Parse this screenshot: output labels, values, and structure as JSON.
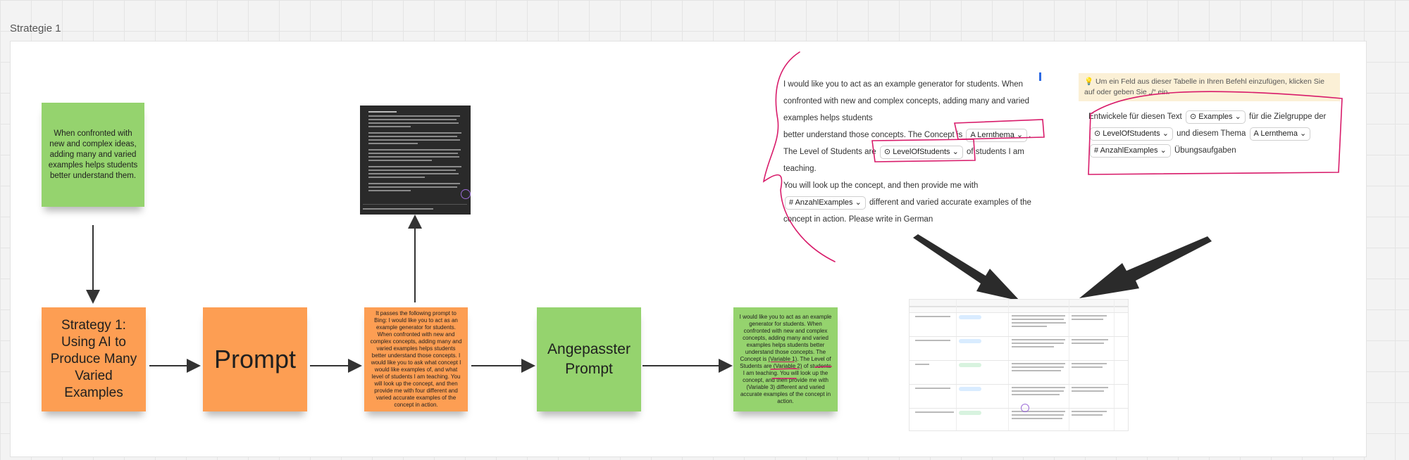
{
  "frame": {
    "label": "Strategie 1"
  },
  "stickies": {
    "intro": "When confronted with new and complex ideas, adding many and varied examples helps students better understand them.",
    "strategy": "Strategy 1: Using AI to Produce Many Varied Examples",
    "prompt": "Prompt",
    "bing": "It passes the following prompt to Bing: I would like you to act as an example generator for students. When confronted with new and complex concepts, adding many and varied examples helps students better understand those concepts. I would like you to ask what concept I would like examples of, and what level of students I am teaching. You will look up the concept, and then provide me with four different and varied accurate examples of the concept in action.",
    "adapted": "Angepasster Prompt",
    "variable_before": "I would like you to act as an example generator for students. When confronted with new and complex concepts, adding many and varied examples helps students better understand those concepts. The Concept is ",
    "variable_1": "(Variable 1)",
    "variable_mid": ". The Level of Students are ",
    "variable_2": "(Variable 2)",
    "variable_after": " of students I am teaching. You will look up the concept, and then provide me with (Variable 3) different and varied accurate examples of the concept in action."
  },
  "prompt_text": {
    "line1": "I would like you to act as an example generator for students. When confronted with new and complex concepts, adding many and varied examples helps students",
    "line2_pre": "better understand those concepts. The Concept is",
    "chip_lernthema": "Lernthema",
    "line3_pre": "The Level of Students are",
    "chip_level": "LevelOfStudents",
    "line3_post": "of students I am teaching.",
    "line4": "You will look up the concept, and then provide me with",
    "chip_anzahl": "AnzahlExamples",
    "line5_post": "different and varied accurate examples of the concept in action. Please write in German"
  },
  "dialog": {
    "hint": "Um ein Feld aus dieser Tabelle in Ihren Befehl einzufügen, klicken Sie auf oder geben Sie „/“ ein.",
    "t1": "Entwickele für diesen Text",
    "chip_examples": "Examples",
    "t2": "für die Zielgruppe der",
    "chip_level": "LevelOfStudents",
    "t3": "und diesem Thema",
    "chip_lernthema": "Lernthema",
    "chip_anzahl": "AnzahlExamples",
    "t4": "Übungsaufgaben"
  },
  "icons": {
    "chevron": "chevron-down-icon",
    "text_field": "text-field-icon",
    "select_field": "select-field-icon",
    "number_field": "number-field-icon",
    "bulb": "lightbulb-icon"
  },
  "colors": {
    "green": "#95d36e",
    "orange": "#fd9e53",
    "ink": "#d81b6a",
    "arrow": "#2b2b2b"
  }
}
